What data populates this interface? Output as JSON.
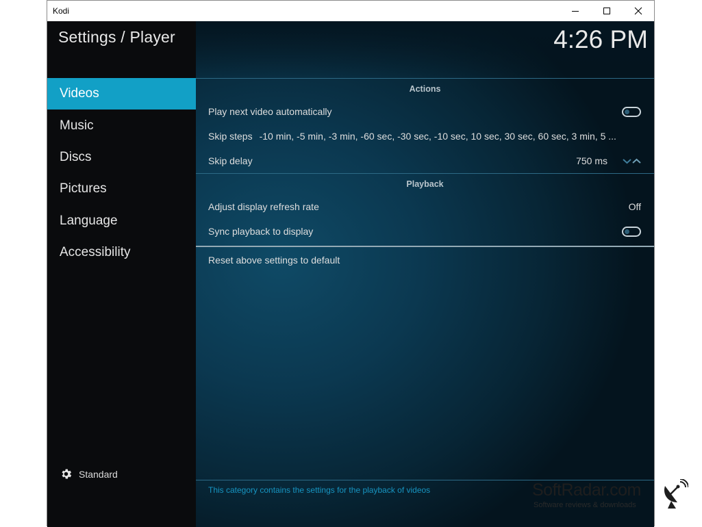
{
  "window": {
    "title": "Kodi"
  },
  "header": {
    "title": "Settings / Player",
    "clock": "4:26 PM"
  },
  "sidebar": {
    "items": [
      {
        "label": "Videos",
        "active": true
      },
      {
        "label": "Music"
      },
      {
        "label": "Discs"
      },
      {
        "label": "Pictures"
      },
      {
        "label": "Language"
      },
      {
        "label": "Accessibility"
      }
    ],
    "level_label": "Standard",
    "level_icon": "gear-icon"
  },
  "sections": {
    "actions": {
      "title": "Actions",
      "play_next": {
        "label": "Play next video automatically",
        "enabled": false
      },
      "skip_steps": {
        "label": "Skip steps",
        "value": "-10 min, -5 min, -3 min, -60 sec, -30 sec, -10 sec, 10 sec, 30 sec, 60 sec, 3 min, 5 ..."
      },
      "skip_delay": {
        "label": "Skip delay",
        "value": "750 ms"
      }
    },
    "playback": {
      "title": "Playback",
      "refresh_rate": {
        "label": "Adjust display refresh rate",
        "value": "Off"
      },
      "sync_playback": {
        "label": "Sync playback to display",
        "enabled": false
      }
    }
  },
  "reset_label": "Reset above settings to default",
  "footer": {
    "description": "This category contains the settings for the playback of videos"
  },
  "watermark": {
    "name": "SoftRadar.com",
    "tagline": "Software reviews & downloads"
  },
  "colors": {
    "accent": "#12a0c6",
    "sidebar_bg": "#0a0b0d",
    "panel_bg": "#0b3850",
    "footer_text": "#1795c2"
  }
}
